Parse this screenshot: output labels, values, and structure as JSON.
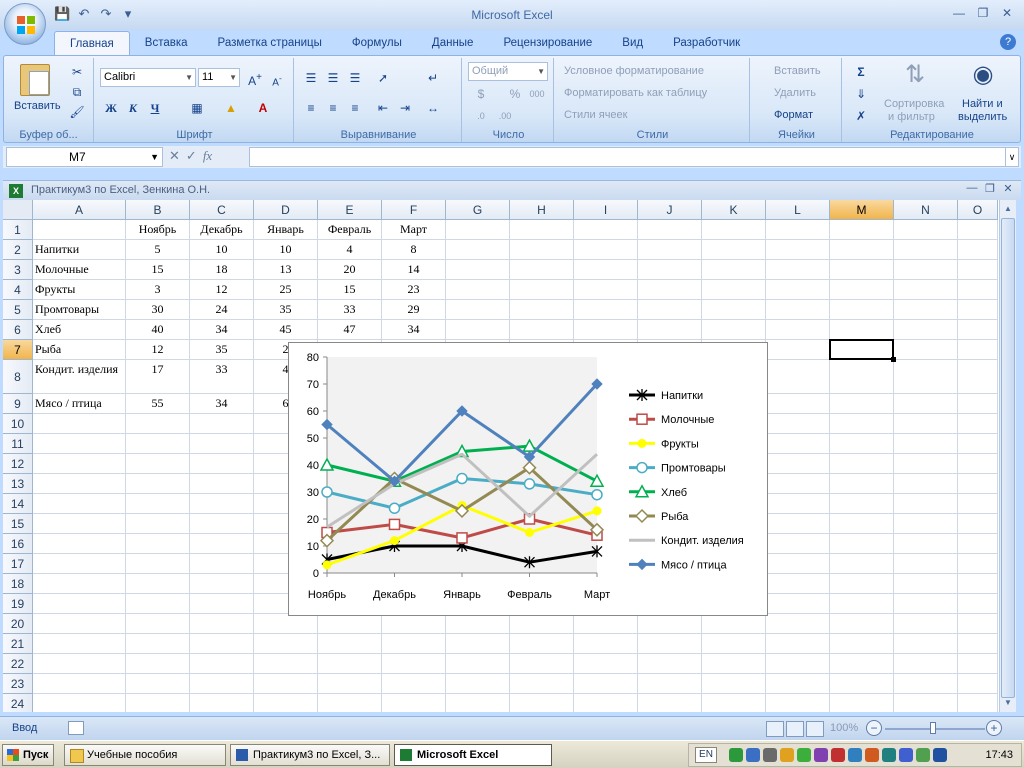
{
  "app": {
    "title": "Microsoft Excel",
    "workbook_title": "Практикум3 по Excel, Зенкина О.Н."
  },
  "ribbon": {
    "tabs": [
      "Главная",
      "Вставка",
      "Разметка страницы",
      "Формулы",
      "Данные",
      "Рецензирование",
      "Вид",
      "Разработчик"
    ],
    "active_tab": "Главная",
    "groups": {
      "clipboard": "Буфер об...",
      "font": "Шрифт",
      "alignment": "Выравнивание",
      "number": "Число",
      "styles": "Стили",
      "cells": "Ячейки",
      "editing": "Редактирование"
    },
    "paste_label": "Вставить",
    "font_name": "Calibri",
    "font_size": "11",
    "bold": "Ж",
    "italic": "К",
    "underline": "Ч",
    "number_format": "Общий",
    "percent": "%",
    "thousands": "000",
    "conditional_formatting": "Условное форматирование",
    "format_as_table": "Форматировать как таблицу",
    "cell_styles": "Стили ячеек",
    "insert": "Вставить",
    "delete": "Удалить",
    "format": "Формат",
    "sort_filter_1": "Сортировка",
    "sort_filter_2": "и фильтр",
    "find_select_1": "Найти и",
    "find_select_2": "выделить"
  },
  "formula_bar": {
    "name_box": "M7",
    "fx": "fx",
    "value": ""
  },
  "sheet": {
    "columns": [
      "A",
      "B",
      "C",
      "D",
      "E",
      "F",
      "G",
      "H",
      "I",
      "J",
      "K",
      "L",
      "M",
      "N",
      "O"
    ],
    "selected_column": "M",
    "selected_row": 7,
    "rows": [
      1,
      2,
      3,
      4,
      5,
      6,
      7,
      8,
      9,
      10,
      11,
      12,
      13,
      14,
      15,
      16,
      17,
      18,
      19,
      20,
      21,
      22,
      23,
      24
    ],
    "header_row": [
      "",
      "Ноябрь",
      "Декабрь",
      "Январь",
      "Февраль",
      "Март"
    ],
    "data": [
      [
        "Напитки",
        "5",
        "10",
        "10",
        "4",
        "8"
      ],
      [
        "Молочные",
        "15",
        "18",
        "13",
        "20",
        "14"
      ],
      [
        "Фрукты",
        "3",
        "12",
        "25",
        "15",
        "23"
      ],
      [
        "Промтовары",
        "30",
        "24",
        "35",
        "33",
        "29"
      ],
      [
        "Хлеб",
        "40",
        "34",
        "45",
        "47",
        "34"
      ],
      [
        "Рыба",
        "12",
        "35",
        "2",
        "",
        ""
      ],
      [
        "Кондит. изделия",
        "17",
        "33",
        "4",
        "",
        ""
      ],
      [
        "Мясо / птица",
        "55",
        "34",
        "6",
        "",
        ""
      ]
    ]
  },
  "chart_data": {
    "type": "line",
    "categories": [
      "Ноябрь",
      "Декабрь",
      "Январь",
      "Февраль",
      "Март"
    ],
    "ylim": [
      0,
      80
    ],
    "yticks": [
      "0",
      "10",
      "20",
      "30",
      "40",
      "50",
      "60",
      "70",
      "80"
    ],
    "legend_position": "right",
    "plot_background": "#f2f2f2",
    "series": [
      {
        "name": "Напитки",
        "values": [
          5,
          10,
          10,
          4,
          8
        ],
        "color": "#000000",
        "marker": "star"
      },
      {
        "name": "Молочные",
        "values": [
          15,
          18,
          13,
          20,
          14
        ],
        "color": "#be4b48",
        "marker": "square"
      },
      {
        "name": "Фрукты",
        "values": [
          3,
          12,
          25,
          15,
          23
        ],
        "color": "#ffff00",
        "marker": "circle-filled"
      },
      {
        "name": "Промтовары",
        "values": [
          30,
          24,
          35,
          33,
          29
        ],
        "color": "#4bacc6",
        "marker": "circle"
      },
      {
        "name": "Хлеб",
        "values": [
          40,
          34,
          45,
          47,
          34
        ],
        "color": "#00b050",
        "marker": "triangle"
      },
      {
        "name": "Рыба",
        "values": [
          12,
          35,
          23,
          39,
          16
        ],
        "color": "#938953",
        "marker": "diamond"
      },
      {
        "name": "Кондит. изделия",
        "values": [
          17,
          33,
          44,
          21,
          44
        ],
        "color": "#c0c0c0",
        "marker": "none"
      },
      {
        "name": "Мясо / птица",
        "values": [
          55,
          34,
          60,
          43,
          70
        ],
        "color": "#4f81bd",
        "marker": "diamond-filled"
      }
    ]
  },
  "status": {
    "ready": "Ввод",
    "zoom": "100%"
  },
  "taskbar": {
    "start": "Пуск",
    "tasks": [
      "Учебные пособия",
      "Практикум3 по Excel, З...",
      "Microsoft Excel"
    ],
    "lang": "EN",
    "clock": "17:43"
  }
}
